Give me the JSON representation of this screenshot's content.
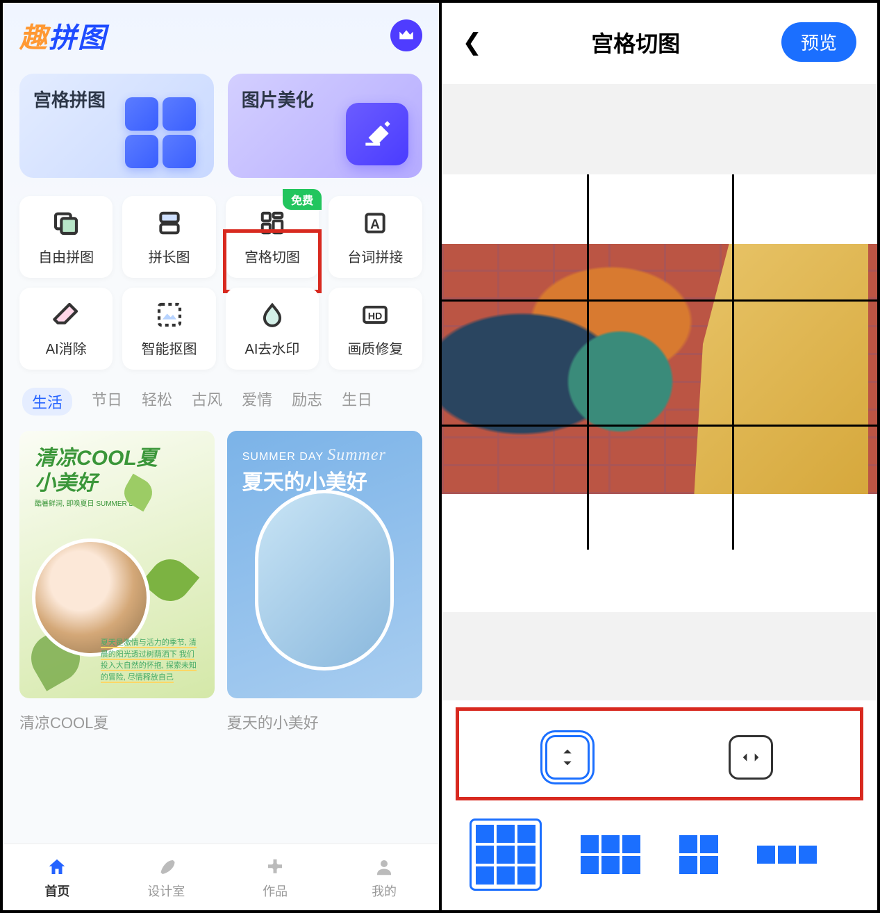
{
  "left": {
    "logo_pre": "趣",
    "logo_post": "拼图",
    "hero": [
      {
        "title": "宫格拼图"
      },
      {
        "title": "图片美化"
      }
    ],
    "tools": [
      {
        "label": "自由拼图",
        "icon": "layers"
      },
      {
        "label": "拼长图",
        "icon": "stack"
      },
      {
        "label": "宫格切图",
        "icon": "grid",
        "badge": "免费",
        "highlight": true
      },
      {
        "label": "台词拼接",
        "icon": "text"
      },
      {
        "label": "AI消除",
        "icon": "eraser"
      },
      {
        "label": "智能抠图",
        "icon": "cutout"
      },
      {
        "label": "AI去水印",
        "icon": "drop"
      },
      {
        "label": "画质修复",
        "icon": "hd"
      }
    ],
    "categories": [
      "生活",
      "节日",
      "轻松",
      "古风",
      "爱情",
      "励志",
      "生日"
    ],
    "active_category": "生活",
    "templates": [
      {
        "name": "清凉COOL夏",
        "title_line1": "清凉COOL夏",
        "title_line2": "小美好",
        "subtitle": "酷暑鲜润, 即唤夏日 SUMMER DAY",
        "caption": "夏天是激情与活力的季节, 清晨的阳光透过树荫洒下 我们投入大自然的怀抱, 探索未知的冒险, 尽情释放自己"
      },
      {
        "name": "夏天的小美好",
        "title_a": "SUMMER DAY",
        "title_cursive": "Summer",
        "title_b": "夏天的小美好"
      }
    ],
    "nav": [
      {
        "label": "首页",
        "active": true
      },
      {
        "label": "设计室"
      },
      {
        "label": "作品"
      },
      {
        "label": "我的"
      }
    ]
  },
  "right": {
    "title": "宫格切图",
    "preview_btn": "预览"
  }
}
